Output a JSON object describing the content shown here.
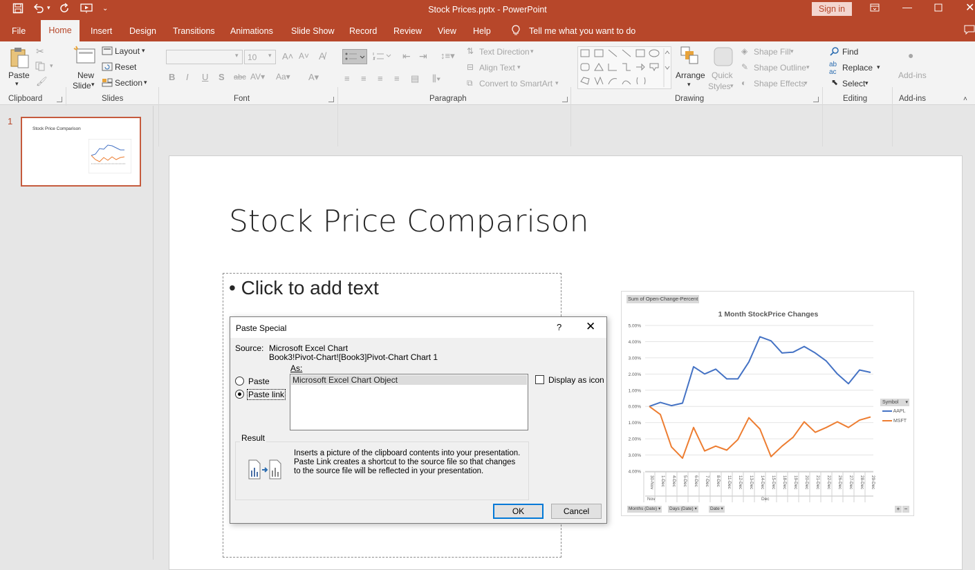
{
  "titlebar": {
    "doc_title": "Stock Prices.pptx  -  PowerPoint",
    "signin": "Sign in"
  },
  "menu": {
    "tabs": [
      "File",
      "Home",
      "Insert",
      "Design",
      "Transitions",
      "Animations",
      "Slide Show",
      "Record",
      "Review",
      "View",
      "Help"
    ],
    "tell_me": "Tell me what you want to do"
  },
  "ribbon": {
    "clipboard": {
      "paste": "Paste",
      "group": "Clipboard"
    },
    "slides": {
      "new_slide_1": "New",
      "new_slide_2": "Slide",
      "layout": "Layout",
      "reset": "Reset",
      "section": "Section",
      "group": "Slides"
    },
    "font": {
      "size": "10",
      "group": "Font"
    },
    "paragraph": {
      "text_direction": "Text Direction",
      "align_text": "Align Text",
      "convert": "Convert to SmartArt",
      "group": "Paragraph"
    },
    "drawing": {
      "arrange": "Arrange",
      "quick_styles_1": "Quick",
      "quick_styles_2": "Styles",
      "shape_fill": "Shape Fill",
      "shape_outline": "Shape Outline",
      "shape_effects": "Shape Effects",
      "group": "Drawing"
    },
    "editing": {
      "find": "Find",
      "replace": "Replace",
      "select": "Select",
      "group": "Editing"
    },
    "addins": {
      "label": "Add-ins",
      "group": "Add-ins"
    }
  },
  "thumbnail": {
    "number": "1",
    "title": "Stock Price Comparison"
  },
  "slide": {
    "title": "Stock Price Comparison",
    "placeholder": "Click to add text"
  },
  "chart": {
    "filter_button": "Sum of Open-Change-Percent",
    "legend_title": "Symbol",
    "axis_buttons": [
      "Months (Date)",
      "Days (Date)",
      "Date"
    ],
    "month_labels": [
      "Nov",
      "Dec"
    ]
  },
  "chart_data": {
    "type": "line",
    "title": "1 Month StockPrice Changes",
    "categories": [
      "30-Nov",
      "1-Dec",
      "4-Dec",
      "5-Dec",
      "6-Dec",
      "7-Dec",
      "8-Dec",
      "11-Dec",
      "12-Dec",
      "13-Dec",
      "14-Dec",
      "15-Dec",
      "18-Dec",
      "19-Dec",
      "20-Dec",
      "21-Dec",
      "22-Dec",
      "26-Dec",
      "27-Dec",
      "28-Dec",
      "29-Dec"
    ],
    "y_ticks": [
      "5.00%",
      "4.00%",
      "3.00%",
      "2.00%",
      "1.00%",
      "0.00%",
      "-1.00%",
      "-2.00%",
      "-3.00%",
      "-4.00%"
    ],
    "y_tick_labels": [
      "5.00%",
      "4.00%",
      "3.00%",
      "2.00%",
      "1.00%",
      "0.00%",
      "1.00%",
      "2.00%",
      "3.00%",
      "4.00%"
    ],
    "ylim": [
      -4,
      5
    ],
    "series": [
      {
        "name": "AAPL",
        "color": "#4472c4",
        "values": [
          0.0,
          0.25,
          0.05,
          0.2,
          2.45,
          2.0,
          2.3,
          1.7,
          1.7,
          2.75,
          4.3,
          4.05,
          3.3,
          3.35,
          3.7,
          3.3,
          2.8,
          2.0,
          1.4,
          2.25,
          2.1
        ]
      },
      {
        "name": "MSFT",
        "color": "#ed7d31",
        "values": [
          0.0,
          -0.5,
          -2.5,
          -3.2,
          -1.3,
          -2.75,
          -2.45,
          -2.7,
          -2.05,
          -0.7,
          -1.4,
          -3.1,
          -2.45,
          -1.9,
          -0.95,
          -1.6,
          -1.3,
          -0.95,
          -1.3,
          -0.85,
          -0.65
        ]
      }
    ]
  },
  "dialog": {
    "title": "Paste Special",
    "help": "?",
    "source_label": "Source:",
    "source_line1": "Microsoft Excel Chart",
    "source_line2": "Book3!Pivot-Chart![Book3]Pivot-Chart Chart 1",
    "as_label": "As:",
    "radio_paste": "Paste",
    "radio_paste_link": "Paste link",
    "as_options": [
      "Microsoft Excel Chart Object"
    ],
    "display_as_icon": "Display as icon",
    "result_label": "Result",
    "result_text": "Inserts a picture of the clipboard contents into your presentation. Paste Link creates a shortcut to the source file so that changes to the source file will be reflected in your presentation.",
    "ok": "OK",
    "cancel": "Cancel"
  }
}
